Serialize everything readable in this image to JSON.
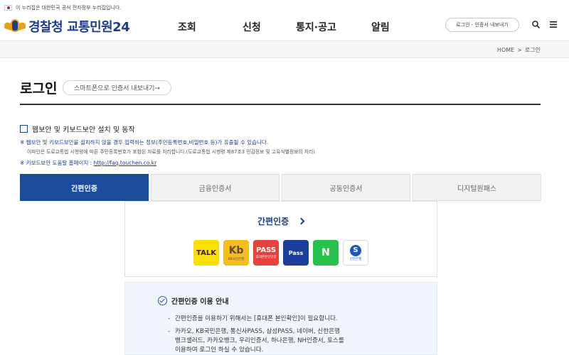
{
  "gov_strip": {
    "text": "이 누리집은 대한민국 공식 전자정부 누리집입니다."
  },
  "header": {
    "logo_text": "경찰청 교통민원24",
    "nav": [
      "조회",
      "신청",
      "통지·공고",
      "알림"
    ],
    "cert_button": "로그인 - 인증서 내보내기"
  },
  "breadcrumb": {
    "home": "HOME",
    "separator": ">",
    "current": "로그인"
  },
  "page": {
    "title": "로그인",
    "export_button": "스마트폰으로 인증서 내보내기→",
    "security_checkbox_label": "웹보안 및 키보드보안 설치 및 동작",
    "note1": "※ 웹보안 및 키보드보안을 설치하지 않을 경우 입력하는 정보(주민등록번호,비밀번호 등)가 유출될 수 있습니다.",
    "note2": "이파인은 도로교통법 시행령에 따른 주민등록번호가 포함된 자료를 처리합니다.(도로교통법 시행령 제87조3 민감정보 및 고유식별정보의 처리)",
    "note3_prefix": "※ 키보드보안 도움말 홈페이지 : ",
    "note3_link": "http://faq.touchen.co.kr"
  },
  "tabs": [
    "간편인증",
    "금융인증서",
    "공동인증서",
    "디지털원패스"
  ],
  "easy_auth": {
    "title": "간편인증",
    "apps": [
      {
        "name": "kakao-talk",
        "label": "TALK",
        "sub": "",
        "bg": "#f9e000",
        "fg": "#3b1e1e"
      },
      {
        "name": "kb-bank",
        "label": "Kb",
        "sub": "KB국민은행",
        "bg": "#f5bd1f",
        "fg": "#5a4a3a"
      },
      {
        "name": "pass",
        "label": "PASS",
        "sub": "휴대폰본인인증",
        "bg": "#e8403d",
        "fg": "#ffffff"
      },
      {
        "name": "samsung-pass",
        "label": "Pass",
        "sub": "",
        "bg": "#1b3d9b",
        "fg": "#ffffff"
      },
      {
        "name": "naver",
        "label": "N",
        "sub": "",
        "bg": "#27c24c",
        "fg": "#ffffff"
      },
      {
        "name": "shinhan-bank",
        "label": "S",
        "sub": "신한은행",
        "bg": "#ffffff",
        "fg": "#1d56c4"
      }
    ]
  },
  "guide": {
    "title": "간편인증 이용 안내",
    "line1": "간편인증을 이용하기 위해서는 [휴대폰 본인확인]이 필요합니다.",
    "line2a": "카카오, KB국민은행, 통신사PASS, 삼성PASS, 네이버, 신한은행",
    "line2b": "뱅크샐러드, 카카오뱅크, 우리인증서, 하나은행, NH인증서, 토스를",
    "line2c": "이용하여 로그인 하실 수 있습니다.",
    "dash": "-"
  }
}
